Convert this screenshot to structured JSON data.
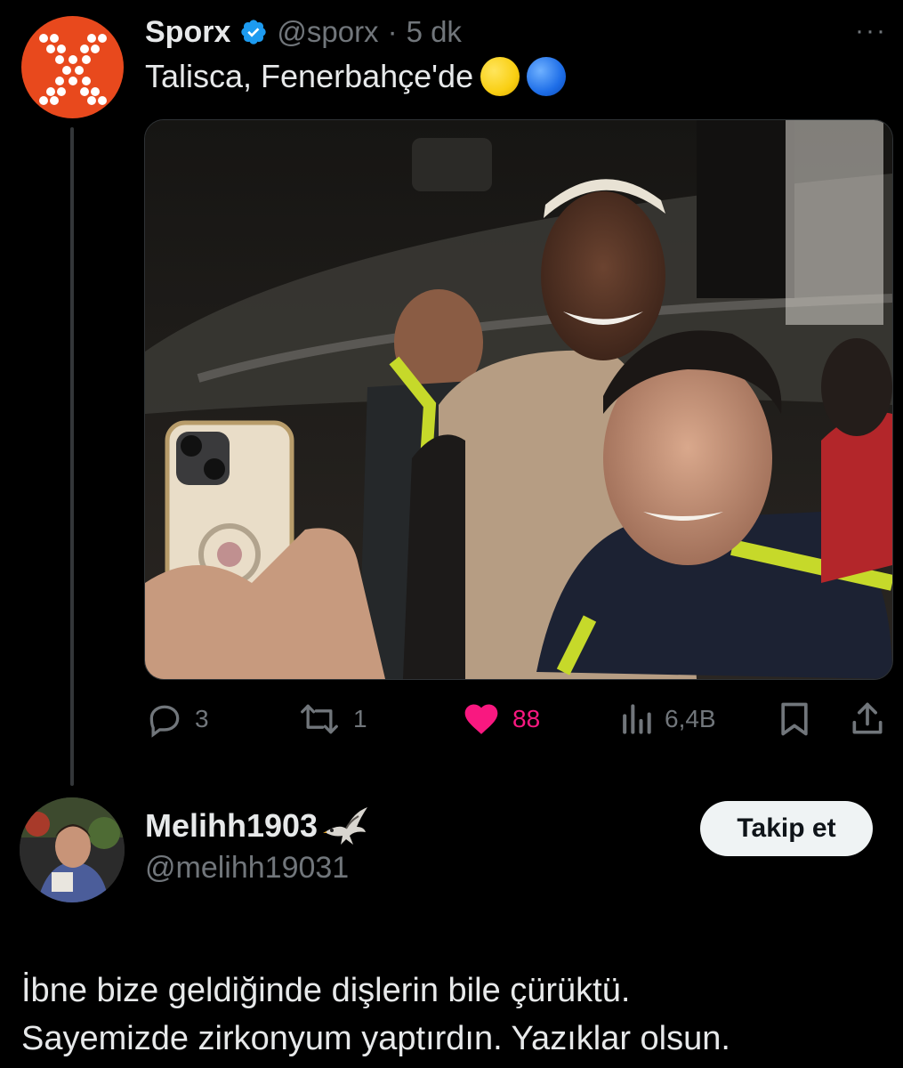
{
  "tweet": {
    "author_name": "Sporx",
    "handle": "@sporx",
    "separator": "·",
    "time": "5 dk",
    "more": "···",
    "text": "Talisca, Fenerbahçe'de",
    "emoji_colors": [
      "#f9cf13",
      "#1e6ee8"
    ],
    "media_alt": "photo",
    "stats": {
      "replies": "3",
      "retweets": "1",
      "likes": "88",
      "views": "6,4B"
    },
    "icons": [
      "reply-icon",
      "retweet-icon",
      "like-icon",
      "views-icon",
      "bookmark-icon",
      "share-icon"
    ],
    "colors": {
      "accent_like": "#f91880",
      "avatar": "#e8491d",
      "verified": "#1d9bf0"
    }
  },
  "reply": {
    "author_name": "Melihh1903",
    "author_emoji": "eagle-icon",
    "handle": "@melihh19031",
    "follow_label": "Takip et",
    "text_lines": [
      "İbne bize geldiğinde dişlerin bile çürüktü.",
      "Sayemizde zirkonyum yaptırdın. Yazıklar olsun."
    ]
  }
}
